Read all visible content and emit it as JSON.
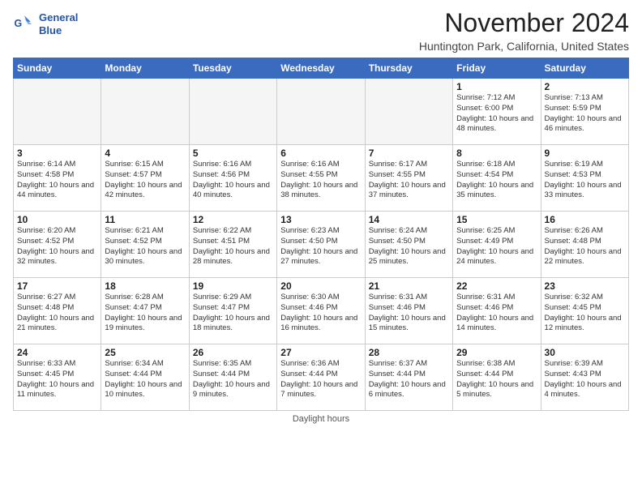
{
  "logo": {
    "line1": "General",
    "line2": "Blue"
  },
  "title": "November 2024",
  "location": "Huntington Park, California, United States",
  "days_of_week": [
    "Sunday",
    "Monday",
    "Tuesday",
    "Wednesday",
    "Thursday",
    "Friday",
    "Saturday"
  ],
  "weeks": [
    [
      {
        "day": "",
        "info": ""
      },
      {
        "day": "",
        "info": ""
      },
      {
        "day": "",
        "info": ""
      },
      {
        "day": "",
        "info": ""
      },
      {
        "day": "",
        "info": ""
      },
      {
        "day": "1",
        "info": "Sunrise: 7:12 AM\nSunset: 6:00 PM\nDaylight: 10 hours and 48 minutes."
      },
      {
        "day": "2",
        "info": "Sunrise: 7:13 AM\nSunset: 5:59 PM\nDaylight: 10 hours and 46 minutes."
      }
    ],
    [
      {
        "day": "3",
        "info": "Sunrise: 6:14 AM\nSunset: 4:58 PM\nDaylight: 10 hours and 44 minutes."
      },
      {
        "day": "4",
        "info": "Sunrise: 6:15 AM\nSunset: 4:57 PM\nDaylight: 10 hours and 42 minutes."
      },
      {
        "day": "5",
        "info": "Sunrise: 6:16 AM\nSunset: 4:56 PM\nDaylight: 10 hours and 40 minutes."
      },
      {
        "day": "6",
        "info": "Sunrise: 6:16 AM\nSunset: 4:55 PM\nDaylight: 10 hours and 38 minutes."
      },
      {
        "day": "7",
        "info": "Sunrise: 6:17 AM\nSunset: 4:55 PM\nDaylight: 10 hours and 37 minutes."
      },
      {
        "day": "8",
        "info": "Sunrise: 6:18 AM\nSunset: 4:54 PM\nDaylight: 10 hours and 35 minutes."
      },
      {
        "day": "9",
        "info": "Sunrise: 6:19 AM\nSunset: 4:53 PM\nDaylight: 10 hours and 33 minutes."
      }
    ],
    [
      {
        "day": "10",
        "info": "Sunrise: 6:20 AM\nSunset: 4:52 PM\nDaylight: 10 hours and 32 minutes."
      },
      {
        "day": "11",
        "info": "Sunrise: 6:21 AM\nSunset: 4:52 PM\nDaylight: 10 hours and 30 minutes."
      },
      {
        "day": "12",
        "info": "Sunrise: 6:22 AM\nSunset: 4:51 PM\nDaylight: 10 hours and 28 minutes."
      },
      {
        "day": "13",
        "info": "Sunrise: 6:23 AM\nSunset: 4:50 PM\nDaylight: 10 hours and 27 minutes."
      },
      {
        "day": "14",
        "info": "Sunrise: 6:24 AM\nSunset: 4:50 PM\nDaylight: 10 hours and 25 minutes."
      },
      {
        "day": "15",
        "info": "Sunrise: 6:25 AM\nSunset: 4:49 PM\nDaylight: 10 hours and 24 minutes."
      },
      {
        "day": "16",
        "info": "Sunrise: 6:26 AM\nSunset: 4:48 PM\nDaylight: 10 hours and 22 minutes."
      }
    ],
    [
      {
        "day": "17",
        "info": "Sunrise: 6:27 AM\nSunset: 4:48 PM\nDaylight: 10 hours and 21 minutes."
      },
      {
        "day": "18",
        "info": "Sunrise: 6:28 AM\nSunset: 4:47 PM\nDaylight: 10 hours and 19 minutes."
      },
      {
        "day": "19",
        "info": "Sunrise: 6:29 AM\nSunset: 4:47 PM\nDaylight: 10 hours and 18 minutes."
      },
      {
        "day": "20",
        "info": "Sunrise: 6:30 AM\nSunset: 4:46 PM\nDaylight: 10 hours and 16 minutes."
      },
      {
        "day": "21",
        "info": "Sunrise: 6:31 AM\nSunset: 4:46 PM\nDaylight: 10 hours and 15 minutes."
      },
      {
        "day": "22",
        "info": "Sunrise: 6:31 AM\nSunset: 4:46 PM\nDaylight: 10 hours and 14 minutes."
      },
      {
        "day": "23",
        "info": "Sunrise: 6:32 AM\nSunset: 4:45 PM\nDaylight: 10 hours and 12 minutes."
      }
    ],
    [
      {
        "day": "24",
        "info": "Sunrise: 6:33 AM\nSunset: 4:45 PM\nDaylight: 10 hours and 11 minutes."
      },
      {
        "day": "25",
        "info": "Sunrise: 6:34 AM\nSunset: 4:44 PM\nDaylight: 10 hours and 10 minutes."
      },
      {
        "day": "26",
        "info": "Sunrise: 6:35 AM\nSunset: 4:44 PM\nDaylight: 10 hours and 9 minutes."
      },
      {
        "day": "27",
        "info": "Sunrise: 6:36 AM\nSunset: 4:44 PM\nDaylight: 10 hours and 7 minutes."
      },
      {
        "day": "28",
        "info": "Sunrise: 6:37 AM\nSunset: 4:44 PM\nDaylight: 10 hours and 6 minutes."
      },
      {
        "day": "29",
        "info": "Sunrise: 6:38 AM\nSunset: 4:44 PM\nDaylight: 10 hours and 5 minutes."
      },
      {
        "day": "30",
        "info": "Sunrise: 6:39 AM\nSunset: 4:43 PM\nDaylight: 10 hours and 4 minutes."
      }
    ]
  ],
  "footer": "Daylight hours"
}
